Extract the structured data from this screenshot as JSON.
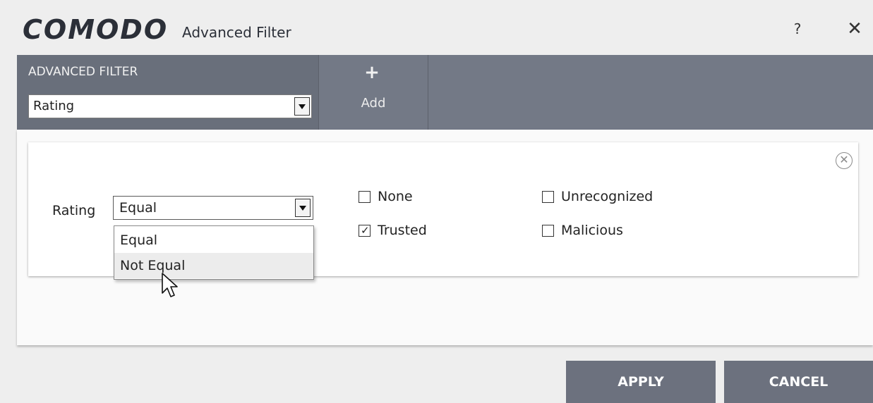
{
  "window": {
    "logo": "COMODO",
    "title": "Advanced Filter",
    "help_label": "?",
    "close_label": "✕"
  },
  "toolbar": {
    "filter_label": "ADVANCED FILTER",
    "filter_value": "Rating",
    "add_label": "Add"
  },
  "rule": {
    "field_label": "Rating",
    "operator_value": "Equal",
    "operator_options": [
      "Equal",
      "Not Equal"
    ],
    "remove_label": "✕",
    "checkboxes": [
      {
        "label": "None",
        "checked": false
      },
      {
        "label": "Trusted",
        "checked": true
      },
      {
        "label": "Unrecognized",
        "checked": false
      },
      {
        "label": "Malicious",
        "checked": false
      }
    ]
  },
  "footer": {
    "apply_label": "APPLY",
    "cancel_label": "CANCEL"
  },
  "colors": {
    "toolbar": "#737986",
    "toolbar_dark": "#696f7b",
    "button": "#6c717e"
  }
}
